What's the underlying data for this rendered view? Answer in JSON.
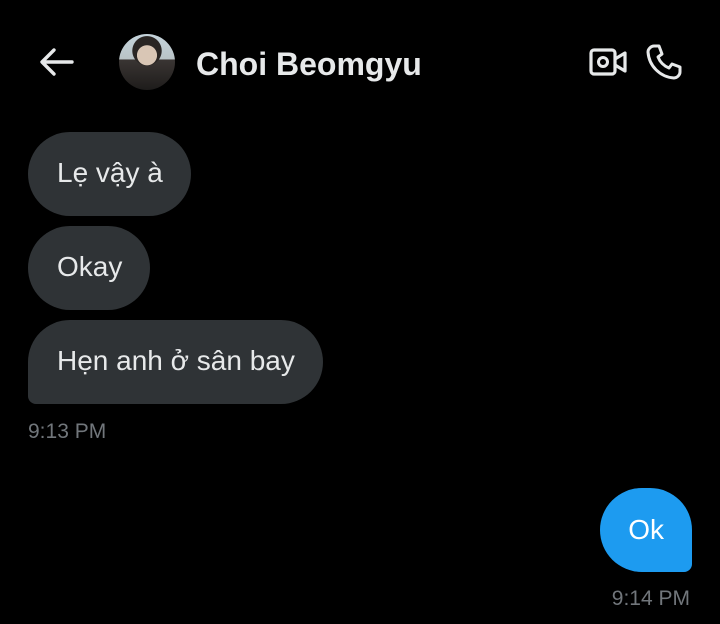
{
  "header": {
    "back_icon": "arrow-left-icon",
    "contact_name": "Choi Beomgyu",
    "video_icon": "video-camera-icon",
    "call_icon": "phone-icon"
  },
  "messages": [
    {
      "direction": "incoming",
      "text": "Lẹ vậy à"
    },
    {
      "direction": "incoming",
      "text": "Okay"
    },
    {
      "direction": "incoming",
      "text": "Hẹn anh ở sân bay"
    },
    {
      "direction": "outgoing",
      "text": "Ok"
    }
  ],
  "timestamps": {
    "incoming_group": "9:13 PM",
    "outgoing_group": "9:14 PM"
  },
  "colors": {
    "background": "#000000",
    "incoming_bubble": "#2f3336",
    "outgoing_bubble": "#1d9bf0",
    "timestamp": "#71767b"
  }
}
